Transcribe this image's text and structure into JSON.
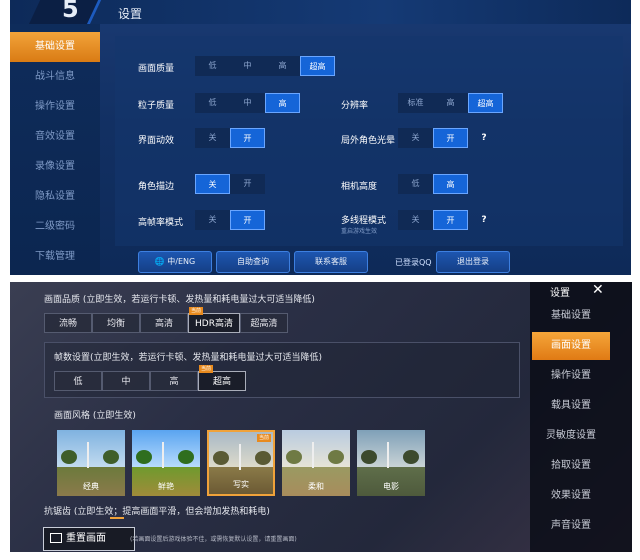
{
  "top": {
    "title": "设置",
    "sidebar": [
      {
        "label": "基础设置",
        "active": true
      },
      {
        "label": "战斗信息",
        "active": false
      },
      {
        "label": "操作设置",
        "active": false
      },
      {
        "label": "音效设置",
        "active": false
      },
      {
        "label": "录像设置",
        "active": false
      },
      {
        "label": "隐私设置",
        "active": false
      },
      {
        "label": "二级密码",
        "active": false
      },
      {
        "label": "下载管理",
        "active": false
      }
    ],
    "settings": {
      "quality": {
        "label": "画面质量",
        "options": [
          "低",
          "中",
          "高",
          "超高"
        ],
        "selected": "超高"
      },
      "particle": {
        "label": "粒子质量",
        "options": [
          "低",
          "中",
          "高"
        ],
        "selected": "高"
      },
      "resolution": {
        "label": "分辨率",
        "options": [
          "标准",
          "高",
          "超高"
        ],
        "selected": "超高"
      },
      "ui_anim": {
        "label": "界面动效",
        "options": [
          "关",
          "开"
        ],
        "selected": "开"
      },
      "outline_glow": {
        "label": "局外角色光晕",
        "options": [
          "关",
          "开"
        ],
        "selected": "开"
      },
      "char_outline": {
        "label": "角色描边",
        "options": [
          "关",
          "开"
        ],
        "selected": "关"
      },
      "cam_height": {
        "label": "相机高度",
        "options": [
          "低",
          "高"
        ],
        "selected": "高"
      },
      "hfr": {
        "label": "高帧率模式",
        "options": [
          "关",
          "开"
        ],
        "selected": "开"
      },
      "multithread": {
        "label": "多线程模式",
        "sublabel": "重启游戏生效",
        "options": [
          "关",
          "开"
        ],
        "selected": "开"
      }
    },
    "help_label": "?",
    "footer": {
      "lang_btn": "中/ENG",
      "self_help_btn": "自助查询",
      "service_btn": "联系客服",
      "login_status": "已登录QQ",
      "logout_btn": "退出登录"
    }
  },
  "bottom": {
    "title": "设置",
    "close": "✕",
    "sidebar": [
      {
        "label": "基础设置",
        "active": false
      },
      {
        "label": "画面设置",
        "active": true
      },
      {
        "label": "操作设置",
        "active": false
      },
      {
        "label": "载具设置",
        "active": false
      },
      {
        "label": "灵敏度设置",
        "active": false
      },
      {
        "label": "拾取设置",
        "active": false
      },
      {
        "label": "效果设置",
        "active": false
      },
      {
        "label": "声音设置",
        "active": false
      }
    ],
    "quality_heading": "画面品质 (立即生效，若运行卡顿、发热量和耗电量过大可适当降低)",
    "quality_options": [
      "流畅",
      "均衡",
      "高清",
      "HDR高清",
      "超高清"
    ],
    "quality_selected": "HDR高清",
    "current_badge": "当前",
    "fps_heading": "帧数设置(立即生效，若运行卡顿、发热量和耗电量过大可适当降低)",
    "fps_options": [
      "低",
      "中",
      "高",
      "超高"
    ],
    "fps_selected": "超高",
    "style_heading": "画面风格 (立即生效)",
    "styles": [
      "经典",
      "鲜艳",
      "写实",
      "柔和",
      "电影"
    ],
    "style_selected": "写实",
    "aa_heading": "抗锯齿 (立即生效；提高画面平滑，但会增加发热和耗电)",
    "restore_btn": "重置画面",
    "restore_note": "(若画面设置后游戏体验不佳，或需恢复默认设置，请重置画面)",
    "colors": {
      "accent": "#f0a23a",
      "blue": "#1565d8"
    }
  }
}
